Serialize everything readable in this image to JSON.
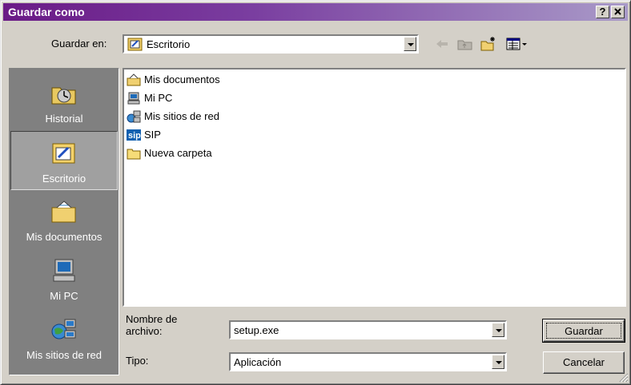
{
  "window": {
    "title": "Guardar como",
    "help_label": "?",
    "close_label": "✕"
  },
  "lookin": {
    "label": "Guardar en:",
    "value": "Escritorio"
  },
  "toolbar": {
    "back_icon": "back-arrow-icon",
    "up_icon": "up-folder-icon",
    "new_folder_icon": "new-folder-icon",
    "views_icon": "views-menu-icon"
  },
  "places": [
    {
      "label": "Historial",
      "icon": "history-icon",
      "selected": false
    },
    {
      "label": "Escritorio",
      "icon": "desktop-icon",
      "selected": true
    },
    {
      "label": "Mis documentos",
      "icon": "my-documents-icon",
      "selected": false
    },
    {
      "label": "Mi PC",
      "icon": "my-computer-icon",
      "selected": false
    },
    {
      "label": "Mis sitios de red",
      "icon": "network-places-icon",
      "selected": false
    }
  ],
  "files": [
    {
      "name": "Mis documentos",
      "icon": "my-documents-icon"
    },
    {
      "name": "Mi PC",
      "icon": "my-computer-icon"
    },
    {
      "name": "Mis sitios de red",
      "icon": "network-places-icon"
    },
    {
      "name": "SIP",
      "icon": "sip-app-icon"
    },
    {
      "name": "Nueva carpeta",
      "icon": "folder-icon"
    }
  ],
  "filename": {
    "label_line1": "Nombre de",
    "label_line2": "archivo:",
    "value": "setup.exe"
  },
  "filetype": {
    "label": "Tipo:",
    "value": "Aplicación"
  },
  "buttons": {
    "save": "Guardar",
    "cancel": "Cancelar"
  },
  "colors": {
    "title_start": "#6a1a86",
    "title_end": "#a99ac8",
    "face": "#d4d0c8"
  }
}
